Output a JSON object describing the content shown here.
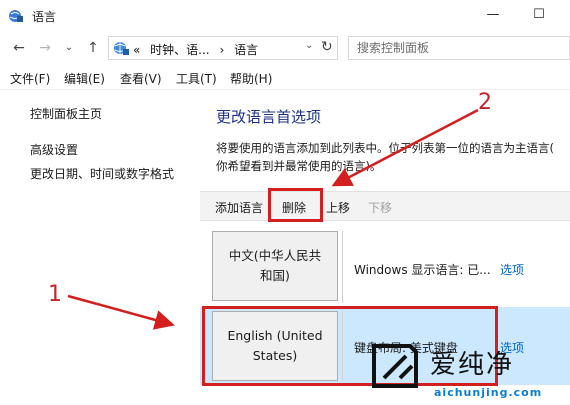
{
  "window": {
    "title": "语言",
    "min_glyph": "—",
    "max_glyph": "☐"
  },
  "address_bar": {
    "overflow": "«",
    "crumbs": [
      "时钟、语...",
      "›",
      "语言"
    ],
    "search_placeholder": "搜索控制面板"
  },
  "menu": [
    {
      "label": "文件(F)"
    },
    {
      "label": "编辑(E)"
    },
    {
      "label": "查看(V)"
    },
    {
      "label": "工具(T)"
    },
    {
      "label": "帮助(H)"
    }
  ],
  "sidebar": {
    "home": "控制面板主页",
    "links": [
      "高级设置",
      "更改日期、时间或数字格式"
    ]
  },
  "main": {
    "heading": "更改语言首选项",
    "desc_line1": "将要使用的语言添加到此列表中。位于列表第一位的语言为主语言(",
    "desc_line2": "你希望看到并最常使用的语言)。",
    "toolbar": {
      "add": "添加语言",
      "remove": "删除",
      "up": "上移",
      "down": "下移"
    },
    "languages": [
      {
        "name_line1": "中文(中华人民共",
        "name_line2": "和国)",
        "info": "Windows 显示语言: 已...",
        "options": "选项"
      },
      {
        "name_line1": "English (United",
        "name_line2": "States)",
        "info": "键盘布局: 美式键盘",
        "options": "选项"
      }
    ]
  },
  "annotations": {
    "label1": "1",
    "label2": "2",
    "color": "#d41f1f"
  },
  "watermark": {
    "name": "爱纯净",
    "url": "aichunjing.com"
  },
  "colors": {
    "heading": "#1e3287",
    "link": "#0066cc",
    "selected_row": "#cce8ff"
  }
}
